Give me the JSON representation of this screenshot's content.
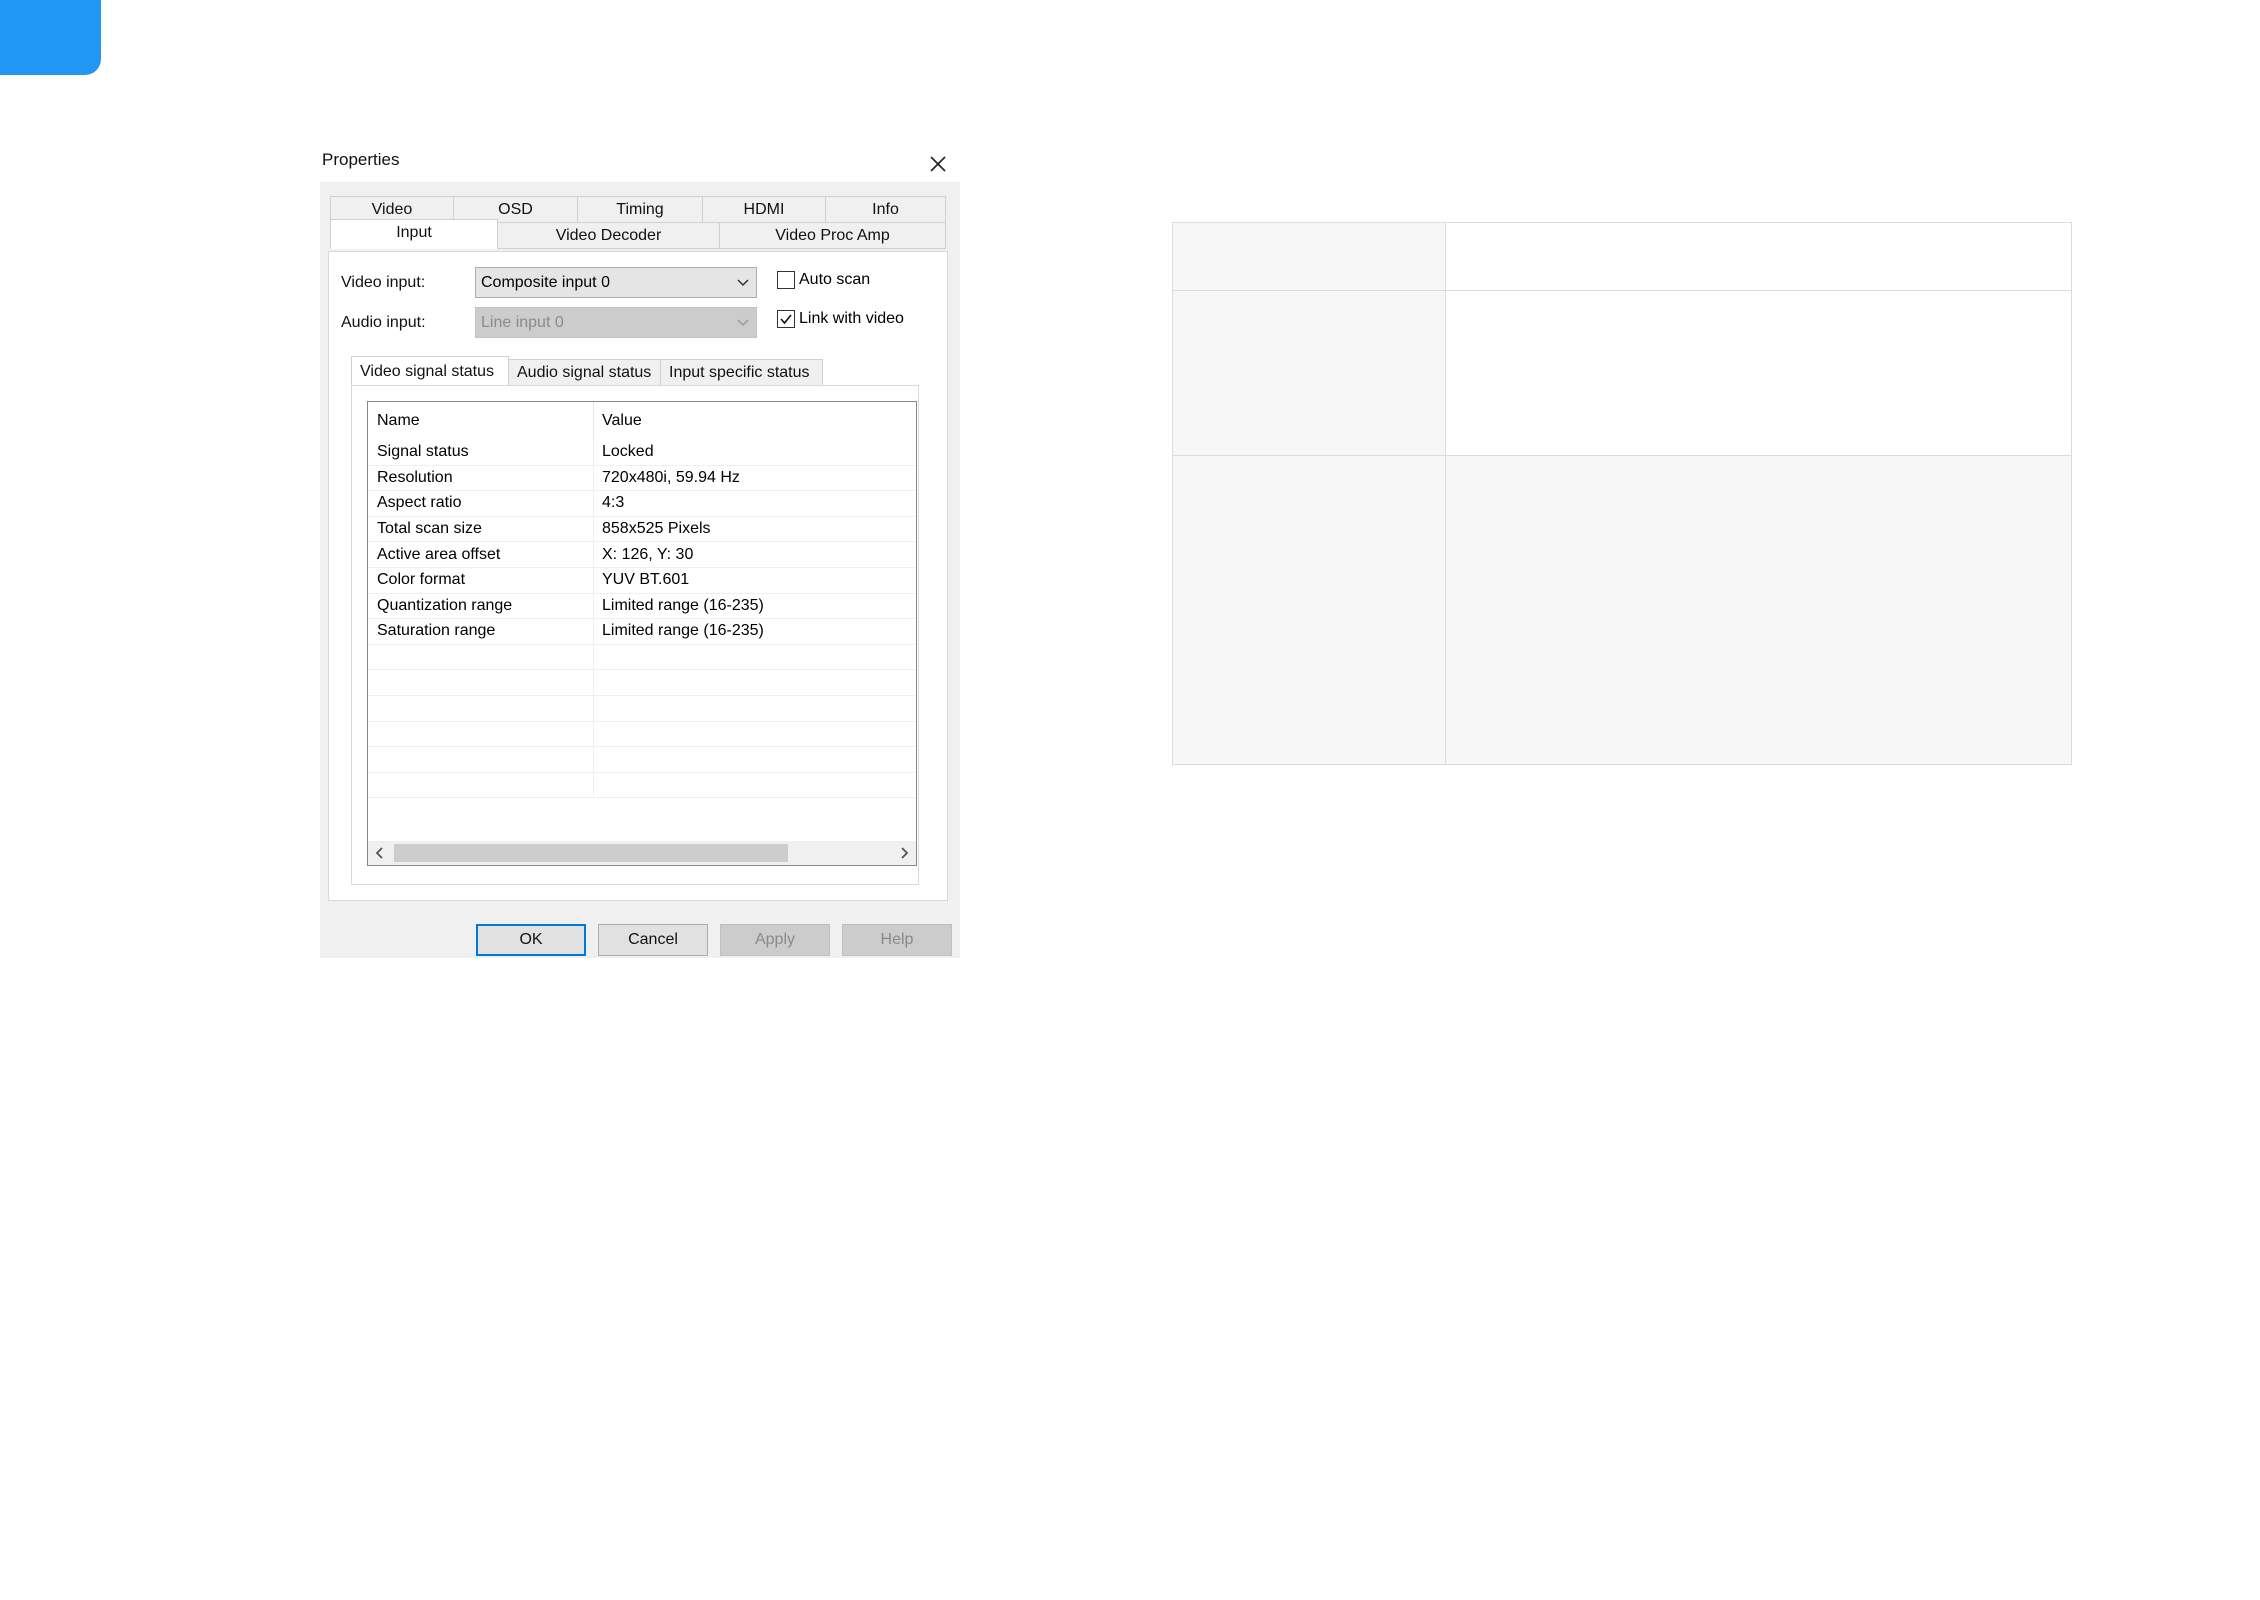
{
  "dialog": {
    "title": "Properties",
    "tabs_row1": [
      "Video",
      "OSD",
      "Timing",
      "HDMI",
      "Info"
    ],
    "tabs_row2": [
      "Input",
      "Video Decoder",
      "Video Proc Amp"
    ],
    "active_tab": "Input",
    "video_input": {
      "label": "Video input:",
      "value": "Composite input 0"
    },
    "audio_input": {
      "label": "Audio input:",
      "value": "Line input 0",
      "disabled": true
    },
    "auto_scan": {
      "label": "Auto scan",
      "checked": false
    },
    "link_with_video": {
      "label": "Link with video",
      "checked": true
    },
    "subtabs": [
      "Video signal status",
      "Audio signal status",
      "Input specific status"
    ],
    "active_subtab": "Video signal status",
    "list": {
      "columns": [
        "Name",
        "Value"
      ],
      "rows": [
        [
          "Signal status",
          "Locked"
        ],
        [
          "Resolution",
          "720x480i, 59.94 Hz"
        ],
        [
          "Aspect ratio",
          "4:3"
        ],
        [
          "Total scan size",
          "858x525 Pixels"
        ],
        [
          "Active area offset",
          "X: 126, Y: 30"
        ],
        [
          "Color format",
          "YUV BT.601"
        ],
        [
          "Quantization range",
          "Limited range (16-235)"
        ],
        [
          "Saturation range",
          "Limited range (16-235)"
        ]
      ]
    },
    "buttons": {
      "ok": "OK",
      "cancel": "Cancel",
      "apply": "Apply",
      "help": "Help"
    }
  },
  "colors": {
    "accent": "#2196f3",
    "focus": "#0078d7",
    "dialog_bg": "#f0f0f0"
  }
}
